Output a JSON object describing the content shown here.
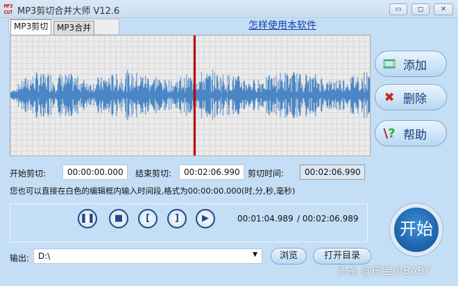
{
  "window": {
    "title": "MP3剪切合并大师 V12.6",
    "icon_text": "MP3 CUT",
    "controls": [
      "minimize",
      "restore",
      "close"
    ]
  },
  "tabs": [
    {
      "label": "MP3剪切",
      "active": true
    },
    {
      "label": "MP3合并",
      "active": false
    }
  ],
  "help_link": "怎样使用本软件",
  "side_buttons": [
    {
      "label": "添加",
      "icon": "film-add-icon"
    },
    {
      "label": "删除",
      "icon": "red-x-icon"
    },
    {
      "label": "帮助",
      "icon": "help-question-icon"
    }
  ],
  "cut": {
    "start_label": "开始剪切:",
    "start_value": "00:00:00.000",
    "end_label": "结束剪切:",
    "end_value": "00:02:06.990",
    "duration_label": "剪切时间:",
    "duration_value": "00:02:06.990"
  },
  "hint": "您也可以直接在白色的编辑框内输入时间段,格式为00:00:00.000(时,分,秒,毫秒)",
  "player": {
    "current": "00:01:04.989",
    "total": "/ 00:02:06.989",
    "buttons": [
      "pause",
      "stop",
      "mark-start",
      "mark-end",
      "play-selection"
    ]
  },
  "start_button": "开始",
  "output": {
    "label": "输出:",
    "value": "D:\\",
    "browse": "浏览",
    "open_dir": "打开目录"
  },
  "watermark": "头条 @彤宝小BABY",
  "colors": {
    "waveform": "#4a86c5",
    "cursor": "#b00000",
    "background": "#c4def5"
  }
}
